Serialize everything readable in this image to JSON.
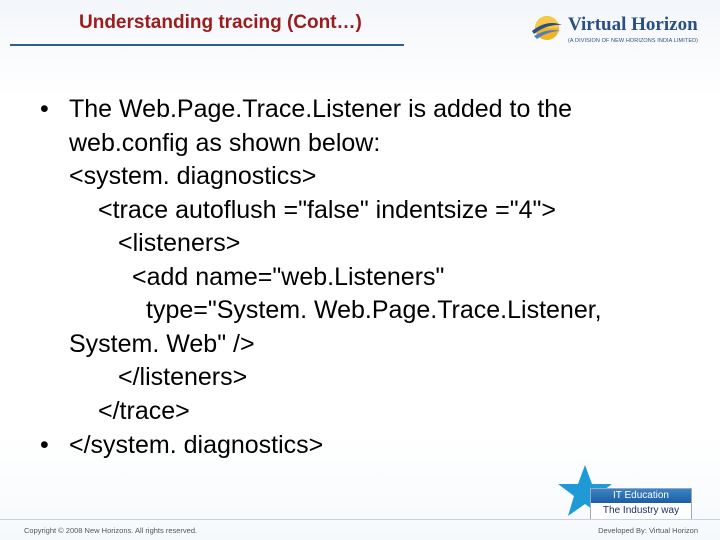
{
  "header": {
    "title": "Understanding tracing (Cont…)",
    "logo_name": "Virtual Horizon",
    "logo_sub": "(A DIVISION OF NEW HORIZONS INDIA LIMITED)"
  },
  "content": {
    "bullets": [
      {
        "lines": [
          "The Web.Page.Trace.Listener is added to the",
          "web.config as shown below:",
          "<system. diagnostics>",
          "<trace autoflush =\"false\" indentsize =\"4\">",
          "<listeners>",
          "<add name=\"web.Listeners\"",
          "type=\"System. Web.Page.Trace.Listener,",
          "System. Web\" />",
          "</listeners>",
          "</trace>"
        ]
      },
      {
        "lines": [
          "</system. diagnostics>"
        ]
      }
    ]
  },
  "badge": {
    "line1": "IT Education",
    "line2": "The Industry way"
  },
  "footer": {
    "copyright": "Copyright © 2008 New Horizons. All rights reserved.",
    "developer": "Developed By: Virtual Horizon"
  },
  "colors": {
    "title": "#9b1c1c",
    "brand_blue": "#2a4f85",
    "rule": "#2f5f8f"
  }
}
